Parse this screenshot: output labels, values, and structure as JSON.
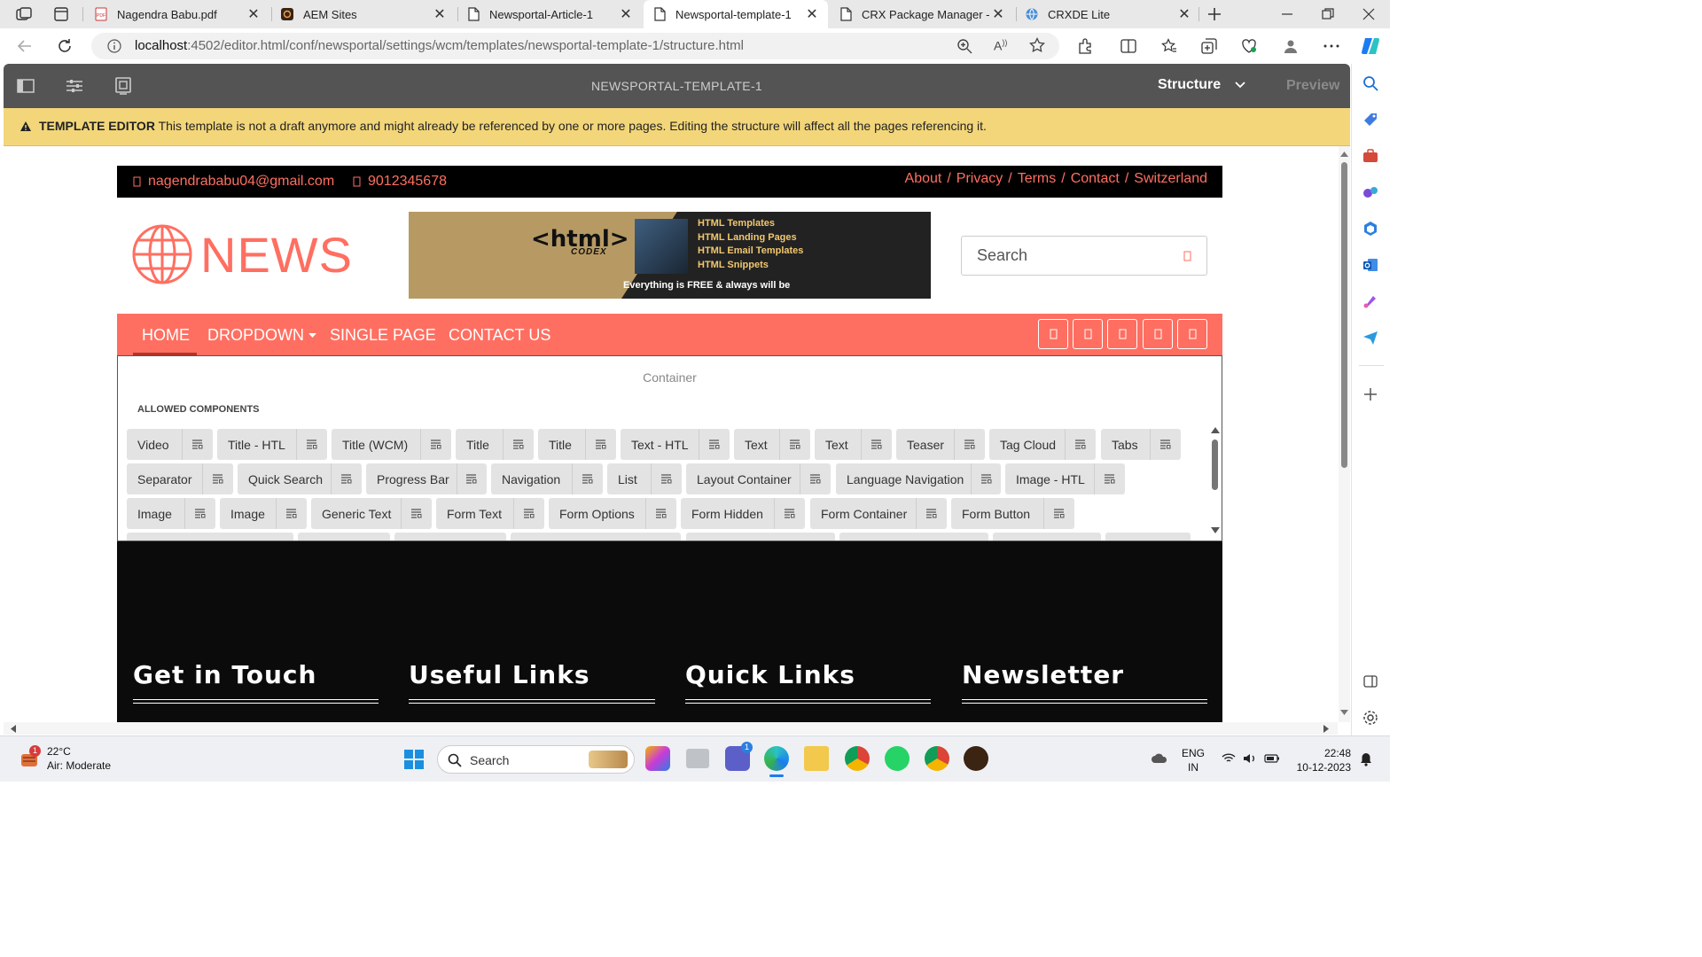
{
  "browser": {
    "tabs": [
      {
        "label": "Nagendra Babu.pdf",
        "icon": "pdf-icon"
      },
      {
        "label": "AEM Sites",
        "icon": "aem-icon"
      },
      {
        "label": "Newsportal-Article-1",
        "icon": "page-icon"
      },
      {
        "label": "Newsportal-template-1",
        "icon": "page-icon",
        "active": true
      },
      {
        "label": "CRX Package Manager - /e",
        "icon": "page-icon"
      },
      {
        "label": "CRXDE Lite",
        "icon": "globe-icon"
      }
    ],
    "url_host": "localhost",
    "url_rest": ":4502/editor.html/conf/newsportal/settings/wcm/templates/newsportal-template-1/structure.html"
  },
  "aem": {
    "title": "NEWSPORTAL-TEMPLATE-1",
    "mode": "Structure",
    "preview": "Preview",
    "warning_label": "TEMPLATE EDITOR",
    "warning_text": "This template is not a draft anymore and might already be referenced by one or more pages. Editing the structure will affect all the pages referencing it."
  },
  "site": {
    "email": "nagendrababu04@gmail.com",
    "phone": "9012345678",
    "top_links": [
      "About",
      "Privacy",
      "Terms",
      "Contact",
      "Switzerland"
    ],
    "logo_text": "NEWS",
    "banner": {
      "brand": "<html>",
      "brand_sub": "CODEX",
      "items": [
        "HTML Templates",
        "HTML Landing Pages",
        "HTML Email Templates",
        "HTML Snippets"
      ],
      "tagline": "Everything is FREE & always will be"
    },
    "search_placeholder": "Search",
    "nav": [
      "HOME",
      "DROPDOWN",
      "SINGLE PAGE",
      "CONTACT US"
    ],
    "container_label": "Container",
    "allowed_label": "ALLOWED COMPONENTS",
    "components_row1": [
      "Video",
      "Title - HTL",
      "Title (WCM)",
      "Title",
      "Title",
      "Text - HTL",
      "Text",
      "Text",
      "Teaser",
      "Tag Cloud",
      "Tabs"
    ],
    "components_row2": [
      "Separator",
      "Quick Search",
      "Progress Bar",
      "Navigation",
      "List",
      "Layout Container",
      "Language Navigation",
      "Image - HTL"
    ],
    "components_row3": [
      "Image",
      "Image",
      "Generic Text",
      "Form Text",
      "Form Options",
      "Form Hidden",
      "Form Container",
      "Form Button"
    ],
    "footer_headings": [
      "Get in Touch",
      "Useful Links",
      "Quick Links",
      "Newsletter"
    ]
  },
  "taskbar": {
    "weather_temp": "22°C",
    "weather_desc": "Air: Moderate",
    "weather_badge": "1",
    "search_label": "Search",
    "lang1": "ENG",
    "lang2": "IN",
    "time": "22:48",
    "date": "10-12-2023"
  },
  "colors": {
    "accent": "#ff6f61",
    "aem_toolbar": "#545454",
    "warning": "#f3d67a",
    "footer": "#0b0b0b"
  }
}
